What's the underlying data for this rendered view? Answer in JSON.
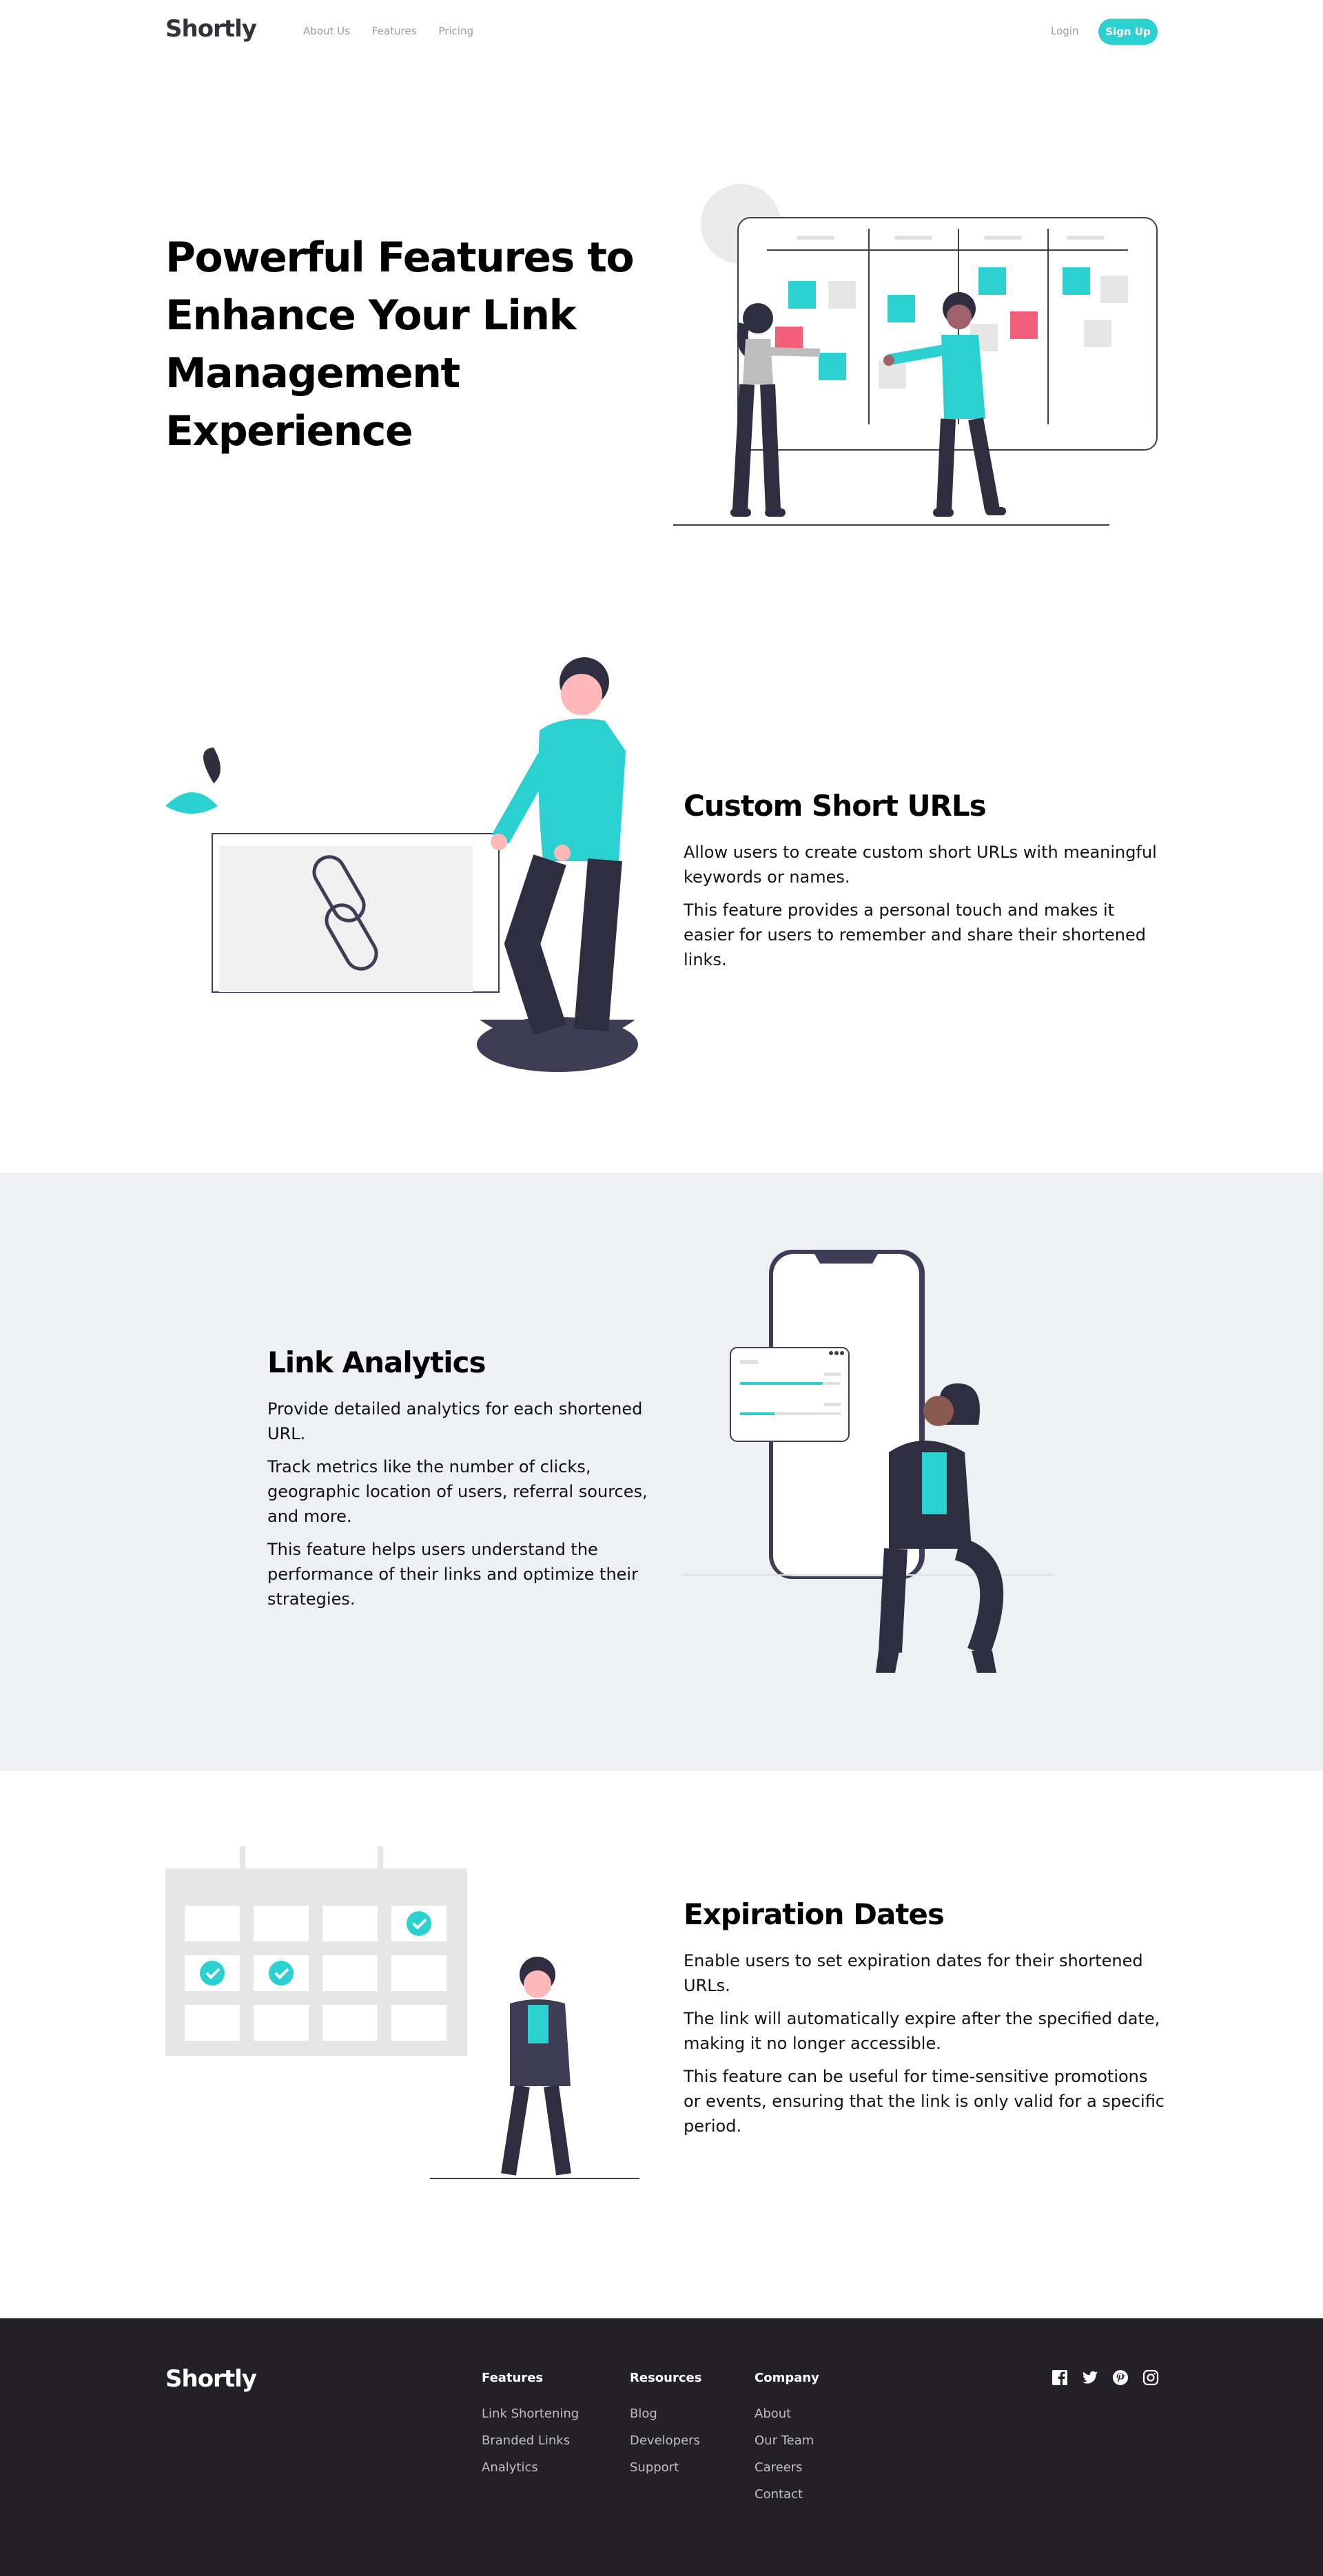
{
  "nav": {
    "logo": "Shortly",
    "links": [
      "About Us",
      "Features",
      "Pricing"
    ],
    "login": "Login",
    "signup": "Sign Up"
  },
  "hero": {
    "title": "Powerful Features to Enhance Your Link Management Experience"
  },
  "features": [
    {
      "title": "Custom Short URLs",
      "paragraphs": [
        "Allow users to create custom short URLs with meaningful keywords or names.",
        "This feature provides a personal touch and makes it easier for users to remember and share their shortened links."
      ]
    },
    {
      "title": "Link Analytics",
      "paragraphs": [
        "Provide detailed analytics for each shortened URL.",
        "Track metrics like the number of clicks, geographic location of users, referral sources, and more.",
        "This feature helps users understand the performance of their links and optimize their strategies."
      ]
    },
    {
      "title": "Expiration Dates",
      "paragraphs": [
        "Enable users to set expiration dates for their shortened URLs.",
        "The link will automatically expire after the specified date, making it no longer accessible.",
        "This feature can be useful for time-sensitive promotions or events, ensuring that the link is only valid for a specific period."
      ]
    }
  ],
  "footer": {
    "logo": "Shortly",
    "columns": [
      {
        "heading": "Features",
        "links": [
          "Link Shortening",
          "Branded Links",
          "Analytics"
        ]
      },
      {
        "heading": "Resources",
        "links": [
          "Blog",
          "Developers",
          "Support"
        ]
      },
      {
        "heading": "Company",
        "links": [
          "About",
          "Our Team",
          "Careers",
          "Contact"
        ]
      }
    ],
    "social": [
      "facebook-icon",
      "twitter-icon",
      "pinterest-icon",
      "instagram-icon"
    ]
  },
  "colors": {
    "accent": "#2bd0d0",
    "dark": "#232027",
    "band": "#eff0f4",
    "pink": "#f25f7a"
  }
}
